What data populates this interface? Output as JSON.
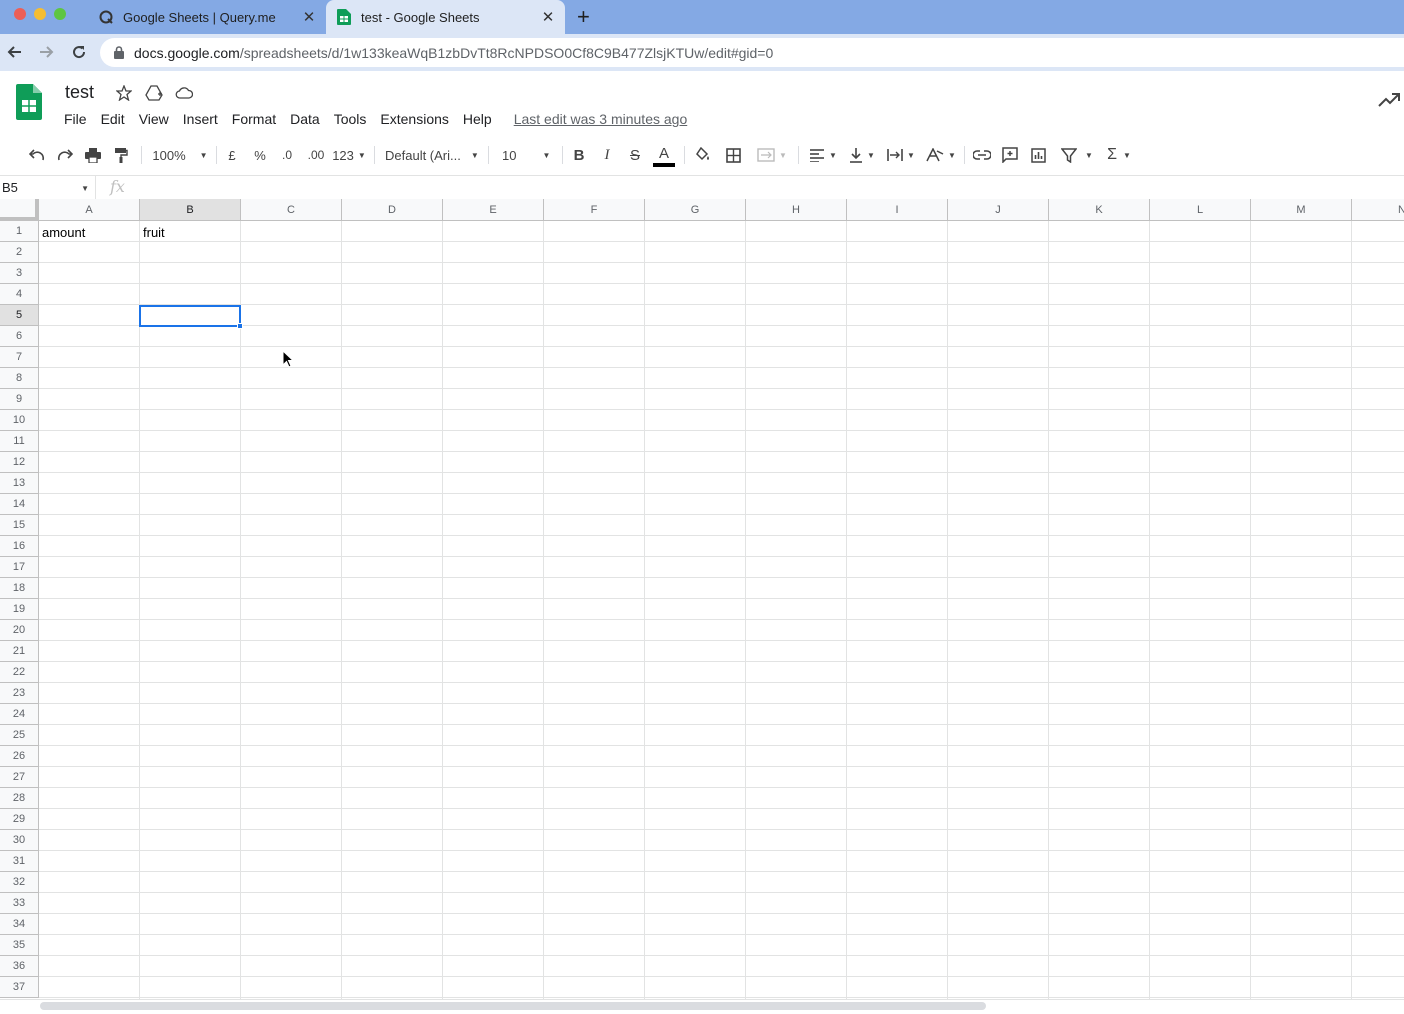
{
  "browser": {
    "tabs": [
      {
        "title": "Google Sheets | Query.me",
        "icon": "query-me-icon"
      },
      {
        "title": "test - Google Sheets",
        "icon": "sheets-favicon"
      }
    ],
    "new_tab": "+",
    "url_domain": "docs.google.com",
    "url_path": "/spreadsheets/d/1w133keaWqB1zbDvTt8RcNPDSO0Cf8C9B477ZlsjKTUw/edit#gid=0"
  },
  "app": {
    "title": "test",
    "menu": [
      "File",
      "Edit",
      "View",
      "Insert",
      "Format",
      "Data",
      "Tools",
      "Extensions",
      "Help"
    ],
    "last_edit": "Last edit was 3 minutes ago"
  },
  "toolbar": {
    "zoom": "100%",
    "currency": "£",
    "percent": "%",
    "decrease_decimal": ".0",
    "increase_decimal": ".00",
    "number_format": "123",
    "font": "Default (Ari...",
    "font_size": "10",
    "bold": "B",
    "italic": "I",
    "strikethrough": "S",
    "text_color": "A",
    "sum": "Σ"
  },
  "formula_bar": {
    "name_box": "B5",
    "fx": "fx",
    "value": ""
  },
  "grid": {
    "columns": [
      "A",
      "B",
      "C",
      "D",
      "E",
      "F",
      "G",
      "H",
      "I",
      "J",
      "K",
      "L",
      "M",
      "N"
    ],
    "rows": [
      "1",
      "2",
      "3",
      "4",
      "5",
      "6",
      "7",
      "8",
      "9",
      "10",
      "11",
      "12",
      "13",
      "14",
      "15",
      "16",
      "17",
      "18",
      "19",
      "20",
      "21",
      "22",
      "23",
      "24",
      "25",
      "26",
      "27",
      "28",
      "29",
      "30",
      "31",
      "32",
      "33",
      "34",
      "35",
      "36",
      "37"
    ],
    "selected_cell": "B5",
    "cells": {
      "A1": "amount",
      "B1": "fruit"
    }
  },
  "colors": {
    "tab_strip": "#84a9e4",
    "selection": "#1a73e8",
    "sheets_green": "#0f9d58"
  }
}
